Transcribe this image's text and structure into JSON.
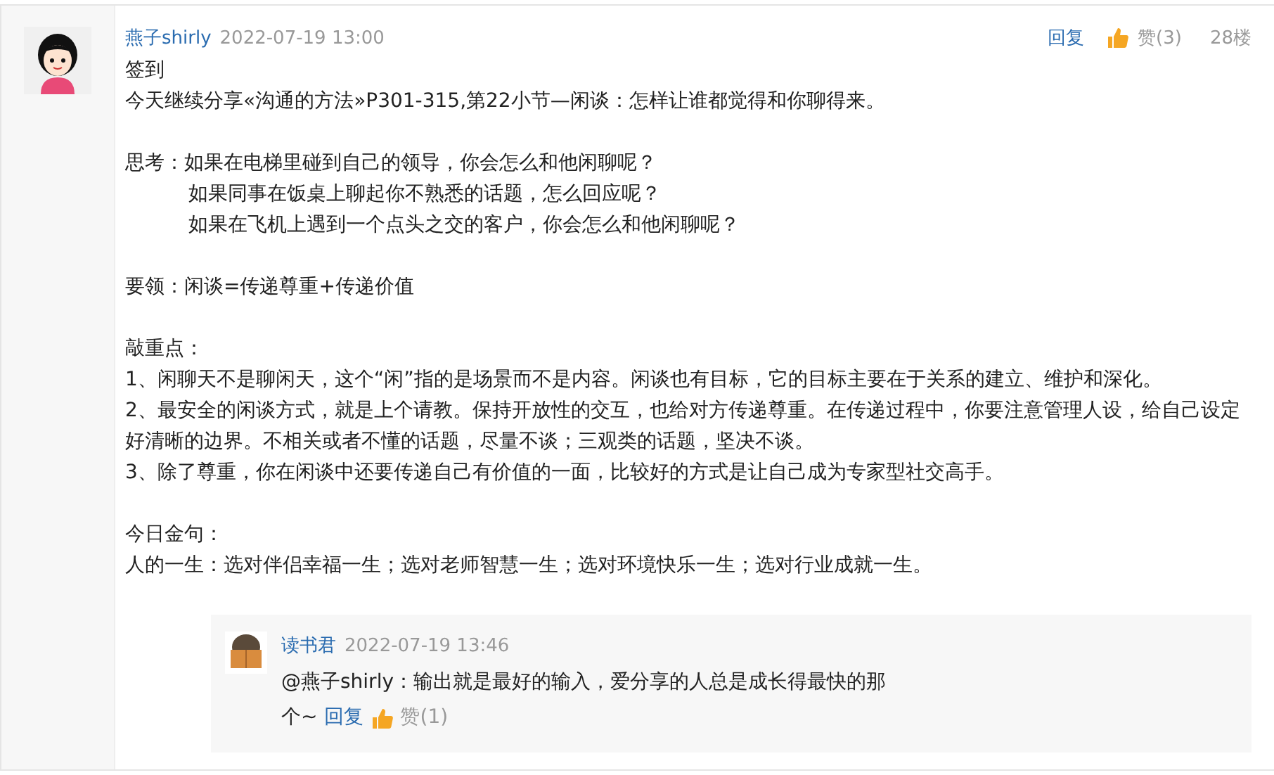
{
  "post": {
    "author": "燕子shirly",
    "time": "2022-07-19 13:00",
    "reply_label": "回复",
    "like_label": "赞(3)",
    "floor": "28楼",
    "paragraphs": [
      {
        "lines": [
          {
            "text": "签到",
            "indent": false
          },
          {
            "text": "今天继续分享«沟通的方法»P301-315,第22小节—闲谈：怎样让谁都觉得和你聊得来。",
            "indent": false
          }
        ]
      },
      {
        "lines": [
          {
            "text": "思考：如果在电梯里碰到自己的领导，你会怎么和他闲聊呢？",
            "indent": false
          },
          {
            "text": "如果同事在饭桌上聊起你不熟悉的话题，怎么回应呢？",
            "indent": true
          },
          {
            "text": "如果在飞机上遇到一个点头之交的客户，你会怎么和他闲聊呢？",
            "indent": true
          }
        ]
      },
      {
        "lines": [
          {
            "text": "要领：闲谈=传递尊重+传递价值",
            "indent": false
          }
        ]
      },
      {
        "lines": [
          {
            "text": "敲重点：",
            "indent": false
          },
          {
            "text": "1、闲聊天不是聊闲天，这个“闲”指的是场景而不是内容。闲谈也有目标，它的目标主要在于关系的建立、维护和深化。",
            "indent": false
          },
          {
            "text": "2、最安全的闲谈方式，就是上个请教。保持开放性的交互，也给对方传递尊重。在传递过程中，你要注意管理人设，给自己设定好清晰的边界。不相关或者不懂的话题，尽量不谈；三观类的话题，坚决不谈。",
            "indent": false
          },
          {
            "text": "3、除了尊重，你在闲谈中还要传递自己有价值的一面，比较好的方式是让自己成为专家型社交高手。",
            "indent": false
          }
        ]
      },
      {
        "lines": [
          {
            "text": "今日金句：",
            "indent": false
          },
          {
            "text": "人的一生：选对伴侣幸福一生；选对老师智慧一生；选对环境快乐一生；选对行业成就一生。",
            "indent": false
          }
        ]
      }
    ]
  },
  "reply": {
    "author": "读书君",
    "time": "2022-07-19 13:46",
    "text_lines": [
      "@燕子shirly：输出就是最好的输入，爱分享的人总是成长得最快的那",
      "个~"
    ],
    "reply_label": "回复",
    "like_label": "赞(1)"
  }
}
